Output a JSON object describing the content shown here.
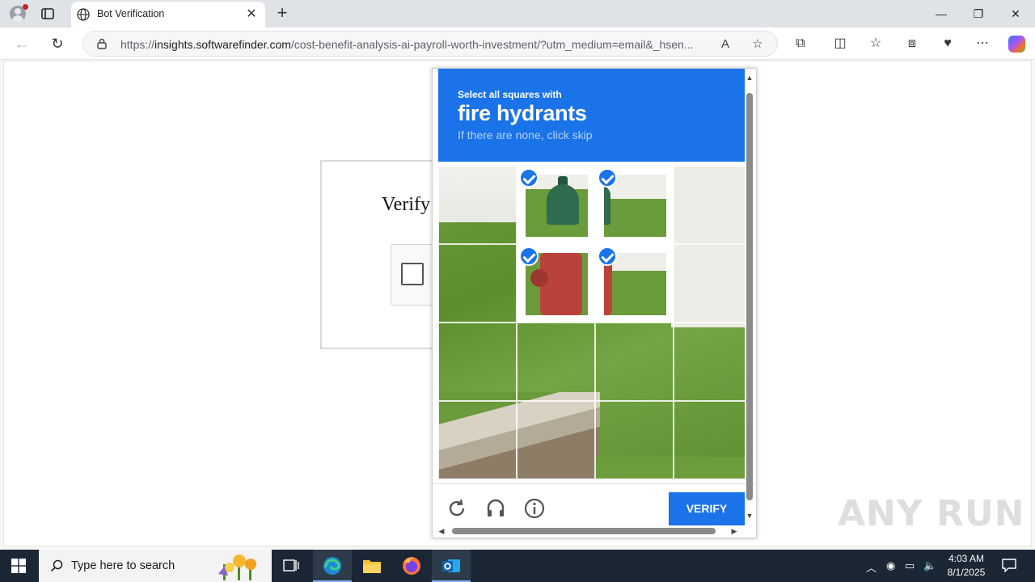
{
  "browser": {
    "tab_title": "Bot Verification",
    "url_scheme": "https://",
    "url_host": "insights.softwarefinder.com",
    "url_path": "/cost-benefit-analysis-ai-payroll-worth-investment/?utm_medium=email&_hsen..."
  },
  "page": {
    "verify_title": "Verify"
  },
  "captcha": {
    "instruction": "Select all squares with",
    "target": "fire hydrants",
    "hint": "If there are none, click skip",
    "verify_label": "VERIFY",
    "grid": {
      "rows": 4,
      "cols": 4,
      "selected": [
        [
          0,
          1
        ],
        [
          0,
          2
        ],
        [
          1,
          1
        ],
        [
          1,
          2
        ]
      ]
    }
  },
  "watermark": "ANY RUN",
  "taskbar": {
    "search_placeholder": "Type here to search",
    "time": "4:03 AM",
    "date": "8/1/2025"
  },
  "colors": {
    "captcha_blue": "#1a73e8",
    "taskbar": "#1b2735"
  }
}
